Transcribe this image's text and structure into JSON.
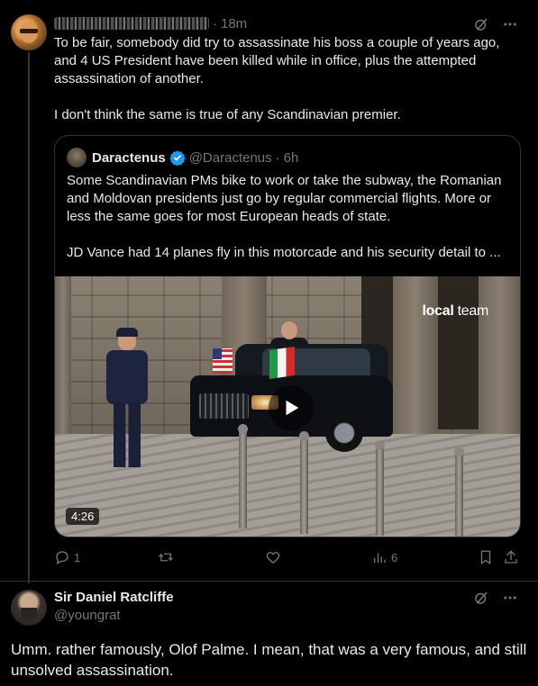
{
  "post1": {
    "time": "18m",
    "separator": "·",
    "paragraph1": "To be fair, somebody did try to assassinate his boss a couple of years ago, and 4 US President have been killed while in office, plus the attempted assassination of another.",
    "paragraph2": "I don't think the same is true of any Scandinavian premier."
  },
  "quote": {
    "name": "Daractenus",
    "handle": "@Daractenus",
    "separator": "·",
    "time": "6h",
    "paragraph1": "Some Scandinavian PMs bike to work or take the subway, the Romanian and Moldovan presidents just go by regular commercial flights. More or less the same goes for most European heads of state.",
    "paragraph2": "JD Vance had 14 planes fly in this motorcade and his security detail to ...",
    "video": {
      "watermark_bold": "local",
      "watermark_rest": " team",
      "duration": "4:26"
    }
  },
  "actions": {
    "replies": "1",
    "retweets": "",
    "likes": "",
    "views": "6"
  },
  "post2": {
    "name": "Sir Daniel Ratcliffe",
    "handle": "@youngrat",
    "text": "Umm. rather famously, Olof Palme. I mean, that was a very famous, and still unsolved assassination."
  },
  "colors": {
    "background": "#000000",
    "text": "#e7e9ea",
    "muted": "#71767b",
    "border": "#2f3336",
    "verified": "#1d9bf0"
  },
  "icons": [
    "grok-icon",
    "more-icon",
    "verified-badge-icon",
    "play-icon",
    "reply-icon",
    "retweet-icon",
    "like-icon",
    "views-icon",
    "bookmark-icon",
    "share-icon"
  ]
}
